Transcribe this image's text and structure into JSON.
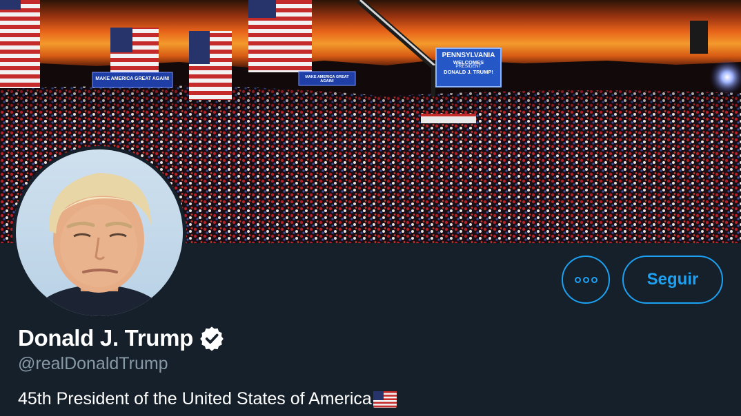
{
  "profile": {
    "display_name": "Donald J. Trump",
    "handle": "@realDonaldTrump",
    "bio_text": "45th President of the United States of America",
    "bio_emoji": "us-flag-emoji",
    "verified": true
  },
  "actions": {
    "more_icon": "more-options-icon",
    "follow_label": "Seguir"
  },
  "banner": {
    "sign_main_line1": "PENNSYLVANIA",
    "sign_main_line2": "WELCOMES",
    "sign_main_line3": "PRESIDENT",
    "sign_main_line4": "DONALD J. TRUMP!",
    "sign_left": "MAKE AMERICA GREAT AGAIN!",
    "sign_mid": "MAKE AMERICA GREAT AGAIN!"
  },
  "colors": {
    "background": "#15202b",
    "accent": "#1da1f2",
    "secondary_text": "#8899a6"
  }
}
